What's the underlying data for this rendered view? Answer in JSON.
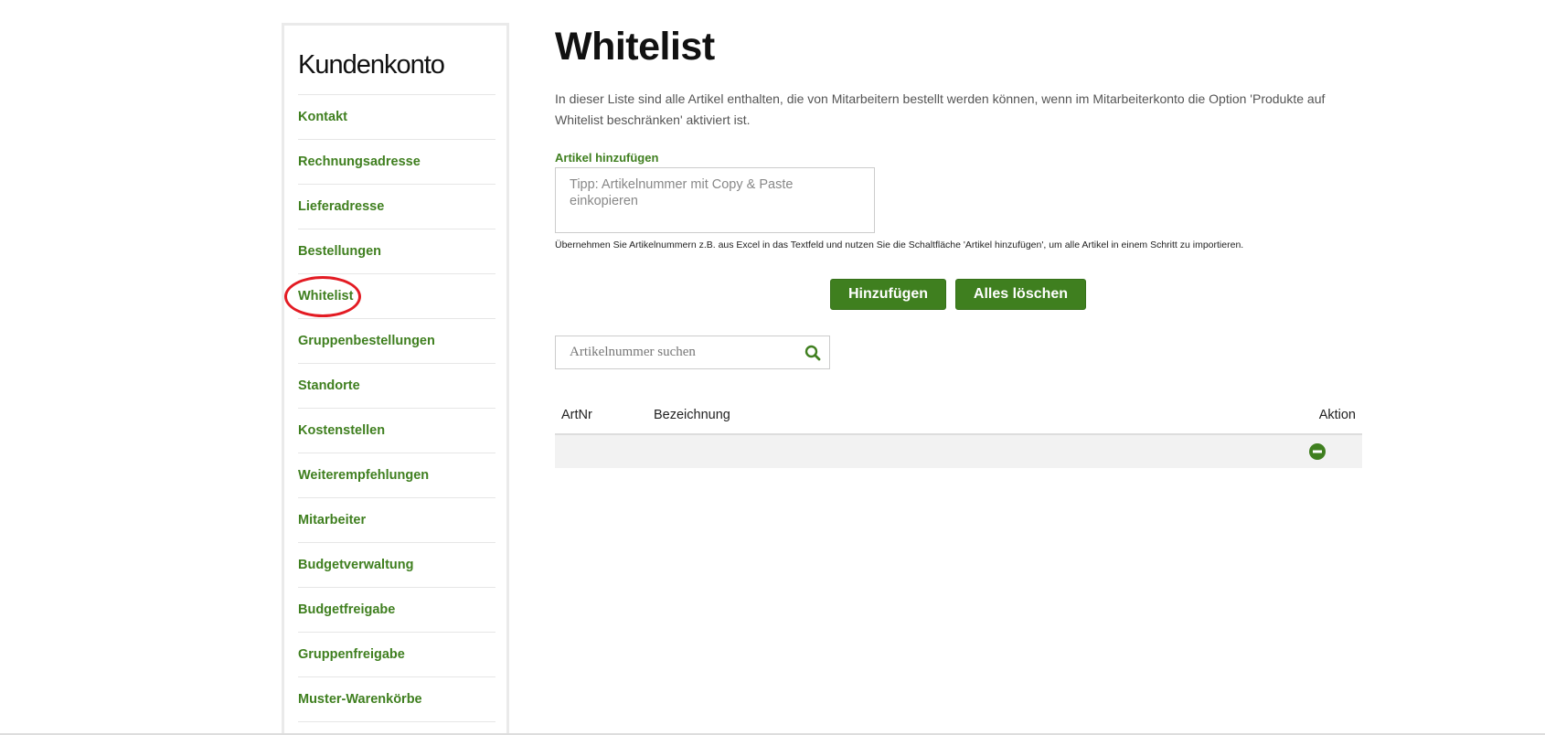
{
  "sidebar": {
    "title": "Kundenkonto",
    "items": [
      {
        "label": "Kontakt"
      },
      {
        "label": "Rechnungsadresse"
      },
      {
        "label": "Lieferadresse"
      },
      {
        "label": "Bestellungen"
      },
      {
        "label": "Whitelist",
        "highlighted": true
      },
      {
        "label": "Gruppenbestellungen"
      },
      {
        "label": "Standorte"
      },
      {
        "label": "Kostenstellen"
      },
      {
        "label": "Weiterempfehlungen"
      },
      {
        "label": "Mitarbeiter"
      },
      {
        "label": "Budgetverwaltung"
      },
      {
        "label": "Budgetfreigabe"
      },
      {
        "label": "Gruppenfreigabe"
      },
      {
        "label": "Muster-Warenkörbe"
      }
    ]
  },
  "main": {
    "title": "Whitelist",
    "intro": "In dieser Liste sind alle Artikel enthalten, die von Mitarbeitern bestellt werden können, wenn im Mitarbeiterkonto die Option 'Produkte auf Whitelist beschränken' aktiviert ist.",
    "add_label": "Artikel hinzufügen",
    "textarea_placeholder": "Tipp: Artikelnummer mit Copy & Paste einkopieren",
    "hint": "Übernehmen Sie Artikelnummern z.B. aus Excel in das Textfeld und nutzen Sie die Schaltfläche 'Artikel hinzufügen', um alle Artikel in einem Schritt zu importieren.",
    "buttons": {
      "add": "Hinzufügen",
      "clear": "Alles löschen"
    },
    "search": {
      "placeholder": "Artikelnummer suchen",
      "icon": "search-icon"
    },
    "table": {
      "columns": [
        "ArtNr",
        "Bezeichnung",
        "Aktion"
      ],
      "rows": [
        {
          "artnr": "",
          "bezeichnung": "",
          "action_icon": "remove-icon"
        }
      ]
    }
  },
  "colors": {
    "accent": "#3f7f1f",
    "highlight_circle": "#e31b23",
    "row_background": "#f2f2f2"
  }
}
